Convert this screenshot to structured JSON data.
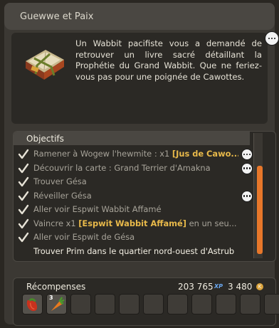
{
  "window": {
    "title": "Guewwe et Paix"
  },
  "quest": {
    "description": "Un Wabbit pacifiste vous a demandé de retrouver un livre sacré détaillant la Prophétie du Grand Wabbit. Que ne feriez-vous pas pour une poignée de Cawottes."
  },
  "objectives": {
    "header": "Objectifs",
    "items": [
      {
        "prefix": "Ramener à Wogew l'hewmite : x1 ",
        "highlight": "[Jus de Cawo...",
        "suffix": "",
        "done": true,
        "chat": true,
        "active": false
      },
      {
        "prefix": "Découvrir la carte : Grand Terrier d'Amakna",
        "highlight": "",
        "suffix": "",
        "done": true,
        "chat": true,
        "active": false
      },
      {
        "prefix": "Trouver Gésa",
        "highlight": "",
        "suffix": "",
        "done": true,
        "chat": false,
        "active": false
      },
      {
        "prefix": "Réveiller Gésa",
        "highlight": "",
        "suffix": "",
        "done": true,
        "chat": true,
        "active": false
      },
      {
        "prefix": "Aller voir Espwit Wabbit Affamé",
        "highlight": "",
        "suffix": "",
        "done": true,
        "chat": false,
        "active": false
      },
      {
        "prefix": "Vaincre x1 ",
        "highlight": "[Espwit Wabbit Affamé]",
        "suffix": " en un seu...",
        "done": true,
        "chat": false,
        "active": false
      },
      {
        "prefix": "Aller voir Espwit de Gésa",
        "highlight": "",
        "suffix": "",
        "done": true,
        "chat": false,
        "active": false
      },
      {
        "prefix": "Trouver Prim dans le quartier nord-ouest d'Astrub",
        "highlight": "",
        "suffix": "",
        "done": false,
        "chat": false,
        "active": true
      }
    ],
    "scroll_fraction": 0.7
  },
  "rewards": {
    "label": "Récompenses",
    "xp": "203 765",
    "xp_unit": "XP",
    "kamas": "3 480",
    "kama_unit": "K",
    "items": [
      {
        "icon": "red-pepper-icon",
        "quantity": ""
      },
      {
        "icon": "carrot-icon",
        "quantity": "3"
      }
    ],
    "empty_slots": 9
  },
  "colors": {
    "accent": "#e8772a",
    "highlight": "#e8b94a",
    "panel": "#3b3833"
  }
}
